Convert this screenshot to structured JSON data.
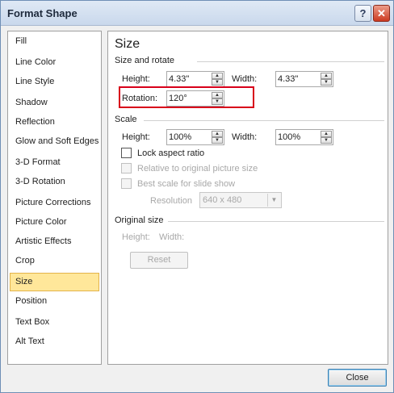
{
  "window": {
    "title": "Format Shape",
    "help_glyph": "?",
    "close_glyph": "✕"
  },
  "nav": {
    "items": [
      {
        "label": "Fill"
      },
      {
        "label": "Line Color"
      },
      {
        "label": "Line Style"
      },
      {
        "label": "Shadow"
      },
      {
        "label": "Reflection"
      },
      {
        "label": "Glow and Soft Edges"
      },
      {
        "label": "3-D Format"
      },
      {
        "label": "3-D Rotation"
      },
      {
        "label": "Picture Corrections"
      },
      {
        "label": "Picture Color"
      },
      {
        "label": "Artistic Effects"
      },
      {
        "label": "Crop"
      },
      {
        "label": "Size"
      },
      {
        "label": "Position"
      },
      {
        "label": "Text Box"
      },
      {
        "label": "Alt Text"
      }
    ],
    "selected": "Size"
  },
  "panel": {
    "title": "Size",
    "size_rotate": {
      "group_label": "Size and rotate",
      "height_label": "Height:",
      "height_value": "4.33\"",
      "width_label": "Width:",
      "width_value": "4.33\"",
      "rotation_label": "Rotation:",
      "rotation_value": "120°"
    },
    "scale": {
      "group_label": "Scale",
      "height_label": "Height:",
      "height_value": "100%",
      "width_label": "Width:",
      "width_value": "100%",
      "lock_aspect_label": "Lock aspect ratio",
      "relative_label": "Relative to original picture size",
      "best_scale_label": "Best scale for slide show",
      "resolution_label": "Resolution",
      "resolution_value": "640 x 480"
    },
    "original": {
      "group_label": "Original size",
      "height_label": "Height:",
      "width_label": "Width:",
      "reset_label": "Reset"
    }
  },
  "footer": {
    "close_label": "Close"
  },
  "colors": {
    "highlight": "#d8001a",
    "selected_nav": "#ffe79a"
  }
}
